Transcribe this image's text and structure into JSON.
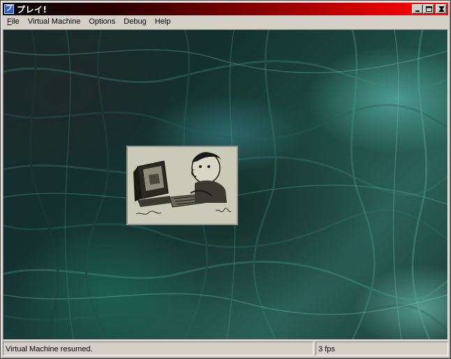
{
  "window": {
    "title": "プレイ!",
    "app_icon_glyph": "プ"
  },
  "menu": {
    "items": [
      {
        "label_first": "F",
        "label_rest": "ile"
      },
      {
        "label_first": "",
        "label_rest": "Virtual Machine"
      },
      {
        "label_first": "",
        "label_rest": "Options"
      },
      {
        "label_first": "",
        "label_rest": "Debug"
      },
      {
        "label_first": "",
        "label_rest": "Help"
      }
    ]
  },
  "icons": {
    "minimize": "minimize-icon",
    "maximize": "maximize-icon",
    "close": "close-icon"
  },
  "status": {
    "message": "Virtual Machine resumed.",
    "fps": "3 fps"
  },
  "colors": {
    "title_gradient_start": "#0a0a0a",
    "title_gradient_end": "#ff1010",
    "chrome": "#d4d0c8"
  }
}
